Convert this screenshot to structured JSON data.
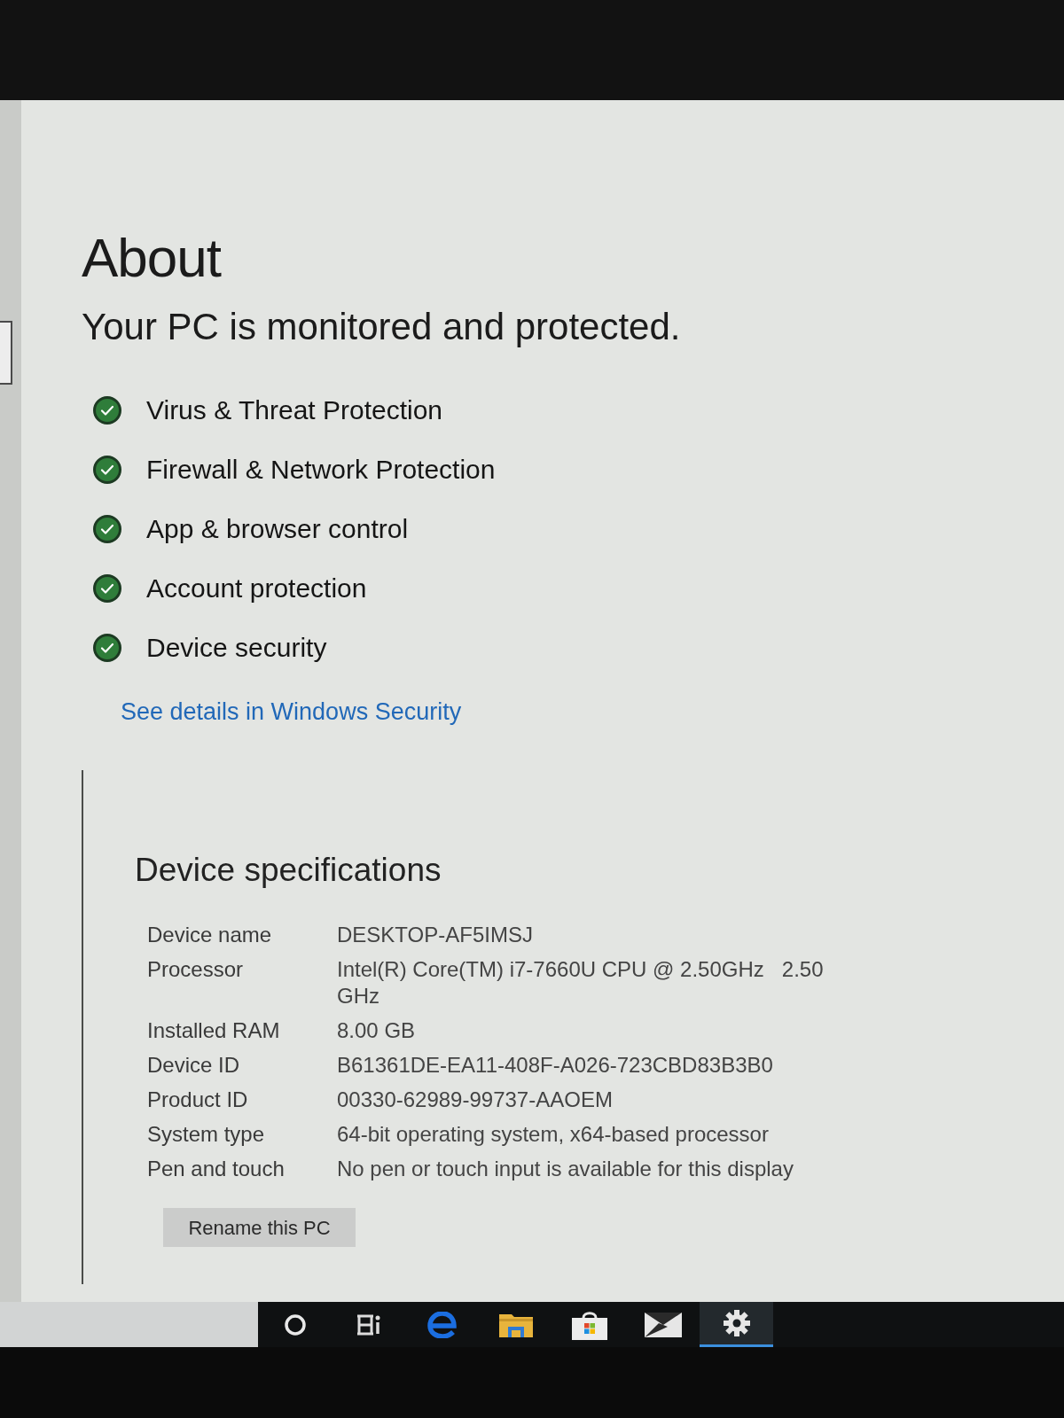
{
  "page": {
    "title": "About"
  },
  "protection": {
    "heading": "Your PC is monitored and protected.",
    "items": [
      {
        "label": "Virus & Threat Protection",
        "protected": true
      },
      {
        "label": "Firewall & Network Protection",
        "protected": true
      },
      {
        "label": "App & browser control",
        "protected": true
      },
      {
        "label": "Account protection",
        "protected": true
      },
      {
        "label": "Device security",
        "protected": true
      }
    ],
    "link": "See details in Windows Security"
  },
  "device_specifications": {
    "heading": "Device specifications",
    "rows": [
      {
        "label": "Device name",
        "value": "DESKTOP-AF5IMSJ"
      },
      {
        "label": "Processor",
        "value": "Intel(R) Core(TM) i7-7660U CPU @ 2.50GHz   2.50 GHz"
      },
      {
        "label": "Installed RAM",
        "value": "8.00 GB"
      },
      {
        "label": "Device ID",
        "value": "B61361DE-EA11-408F-A026-723CBD83B3B0"
      },
      {
        "label": "Product ID",
        "value": "00330-62989-99737-AAOEM"
      },
      {
        "label": "System type",
        "value": "64-bit operating system, x64-based processor"
      },
      {
        "label": "Pen and touch",
        "value": "No pen or touch input is available for this display"
      }
    ],
    "button": "Rename this PC"
  },
  "taskbar": {
    "items": [
      {
        "kind": "cortana",
        "selected": false
      },
      {
        "kind": "task_view",
        "selected": false
      },
      {
        "kind": "browser",
        "selected": false
      },
      {
        "kind": "folder",
        "selected": false
      },
      {
        "kind": "store",
        "selected": false
      },
      {
        "kind": "mail",
        "selected": false
      },
      {
        "kind": "settings",
        "selected": true
      }
    ]
  }
}
